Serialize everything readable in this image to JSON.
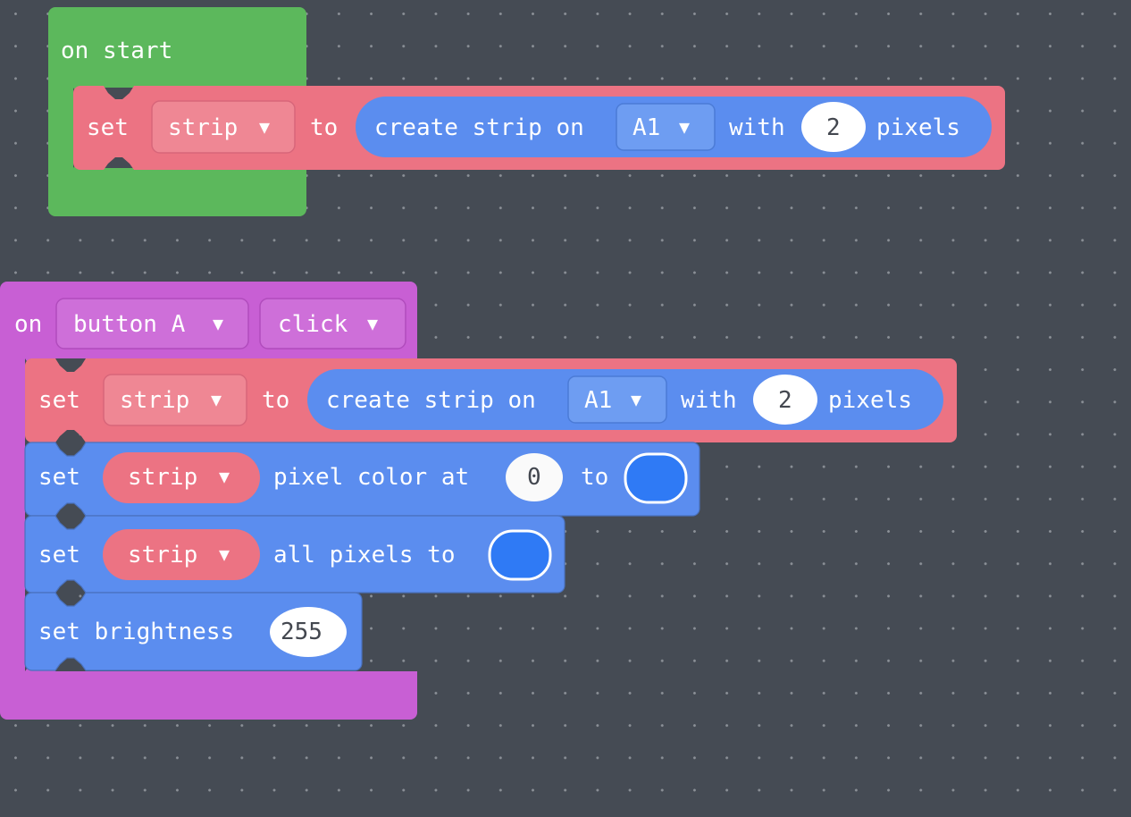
{
  "workspace": {
    "background_color": "#454B54",
    "grid_dot_color": "#8A8F96"
  },
  "palette": {
    "event_green": "#5CB85C",
    "event_green_light": "#69C369",
    "loops_purple": "#C85FD4",
    "variables_red": "#EC7383",
    "variables_red_field": "#EF8794",
    "neopixel_blue": "#5B8DEF",
    "neopixel_blue_field": "#6E9DF2",
    "color_swatch_blue": "#2F7AF5",
    "number_field_bg": "#FFFFFF",
    "number_field_text": "#43474F"
  },
  "scripts": [
    {
      "id": "on-start-script",
      "kind": "event-hat",
      "color": "event_green",
      "label": "on start",
      "children": [
        {
          "id": "set-variable-start",
          "kind": "statement",
          "color": "variables_red",
          "parts": [
            {
              "type": "text",
              "value": "set"
            },
            {
              "type": "dropdown",
              "name": "variable-dropdown",
              "value": "strip",
              "arrow": "▼"
            },
            {
              "type": "text",
              "value": "to"
            },
            {
              "type": "reporter",
              "id": "create-strip-reporter-start",
              "color": "neopixel_blue",
              "parts": [
                {
                  "type": "text",
                  "value": "create strip on"
                },
                {
                  "type": "dropdown",
                  "name": "pin-dropdown",
                  "value": "A1",
                  "arrow": "▼"
                },
                {
                  "type": "text",
                  "value": "with"
                },
                {
                  "type": "number",
                  "name": "pixel-count-field",
                  "value": "2"
                },
                {
                  "type": "text",
                  "value": "pixels"
                }
              ]
            }
          ]
        }
      ]
    },
    {
      "id": "on-button-click-script",
      "kind": "event-hat",
      "color": "loops_purple",
      "parts": [
        {
          "type": "text",
          "value": "on"
        },
        {
          "type": "dropdown",
          "name": "button-dropdown",
          "value": "button A",
          "arrow": "▼"
        },
        {
          "type": "dropdown",
          "name": "event-dropdown",
          "value": "click",
          "arrow": "▼"
        }
      ],
      "children": [
        {
          "id": "set-variable-click",
          "kind": "statement",
          "color": "variables_red",
          "parts": [
            {
              "type": "text",
              "value": "set"
            },
            {
              "type": "dropdown",
              "name": "variable-dropdown",
              "value": "strip",
              "arrow": "▼"
            },
            {
              "type": "text",
              "value": "to"
            },
            {
              "type": "reporter",
              "id": "create-strip-reporter-click",
              "color": "neopixel_blue",
              "parts": [
                {
                  "type": "text",
                  "value": "create strip on"
                },
                {
                  "type": "dropdown",
                  "name": "pin-dropdown",
                  "value": "A1",
                  "arrow": "▼"
                },
                {
                  "type": "text",
                  "value": "with"
                },
                {
                  "type": "number",
                  "name": "pixel-count-field",
                  "value": "2"
                },
                {
                  "type": "text",
                  "value": "pixels"
                }
              ]
            }
          ]
        },
        {
          "id": "set-pixel-color-block",
          "kind": "statement",
          "color": "neopixel_blue",
          "parts": [
            {
              "type": "text",
              "value": "set"
            },
            {
              "type": "variable-pill",
              "name": "strip-variable-pill",
              "value": "strip",
              "arrow": "▼"
            },
            {
              "type": "text",
              "value": "pixel color at"
            },
            {
              "type": "number",
              "name": "pixel-index-field",
              "value": "0"
            },
            {
              "type": "text",
              "value": "to"
            },
            {
              "type": "color-swatch",
              "name": "color-picker-swatch",
              "value": "#2F7AF5"
            }
          ]
        },
        {
          "id": "set-all-pixels-block",
          "kind": "statement",
          "color": "neopixel_blue",
          "parts": [
            {
              "type": "text",
              "value": "set"
            },
            {
              "type": "variable-pill",
              "name": "strip-variable-pill",
              "value": "strip",
              "arrow": "▼"
            },
            {
              "type": "text",
              "value": "all pixels to"
            },
            {
              "type": "color-swatch",
              "name": "color-picker-swatch",
              "value": "#2F7AF5"
            }
          ]
        },
        {
          "id": "set-brightness-block",
          "kind": "statement",
          "color": "neopixel_blue",
          "parts": [
            {
              "type": "text",
              "value": "set brightness"
            },
            {
              "type": "number",
              "name": "brightness-field",
              "value": "255"
            }
          ]
        }
      ]
    }
  ],
  "text": {
    "on_start": "on start",
    "set": "set",
    "to": "to",
    "on": "on",
    "with": "with",
    "pixels": "pixels",
    "create_strip_on": "create strip on",
    "strip": "strip",
    "a1": "A1",
    "button_a": "button A",
    "click": "click",
    "pixel_color_at": "pixel color at",
    "all_pixels_to": "all pixels to",
    "set_brightness": "set brightness",
    "num_two": "2",
    "num_zero": "0",
    "num_255": "255",
    "arrow": "▼"
  }
}
